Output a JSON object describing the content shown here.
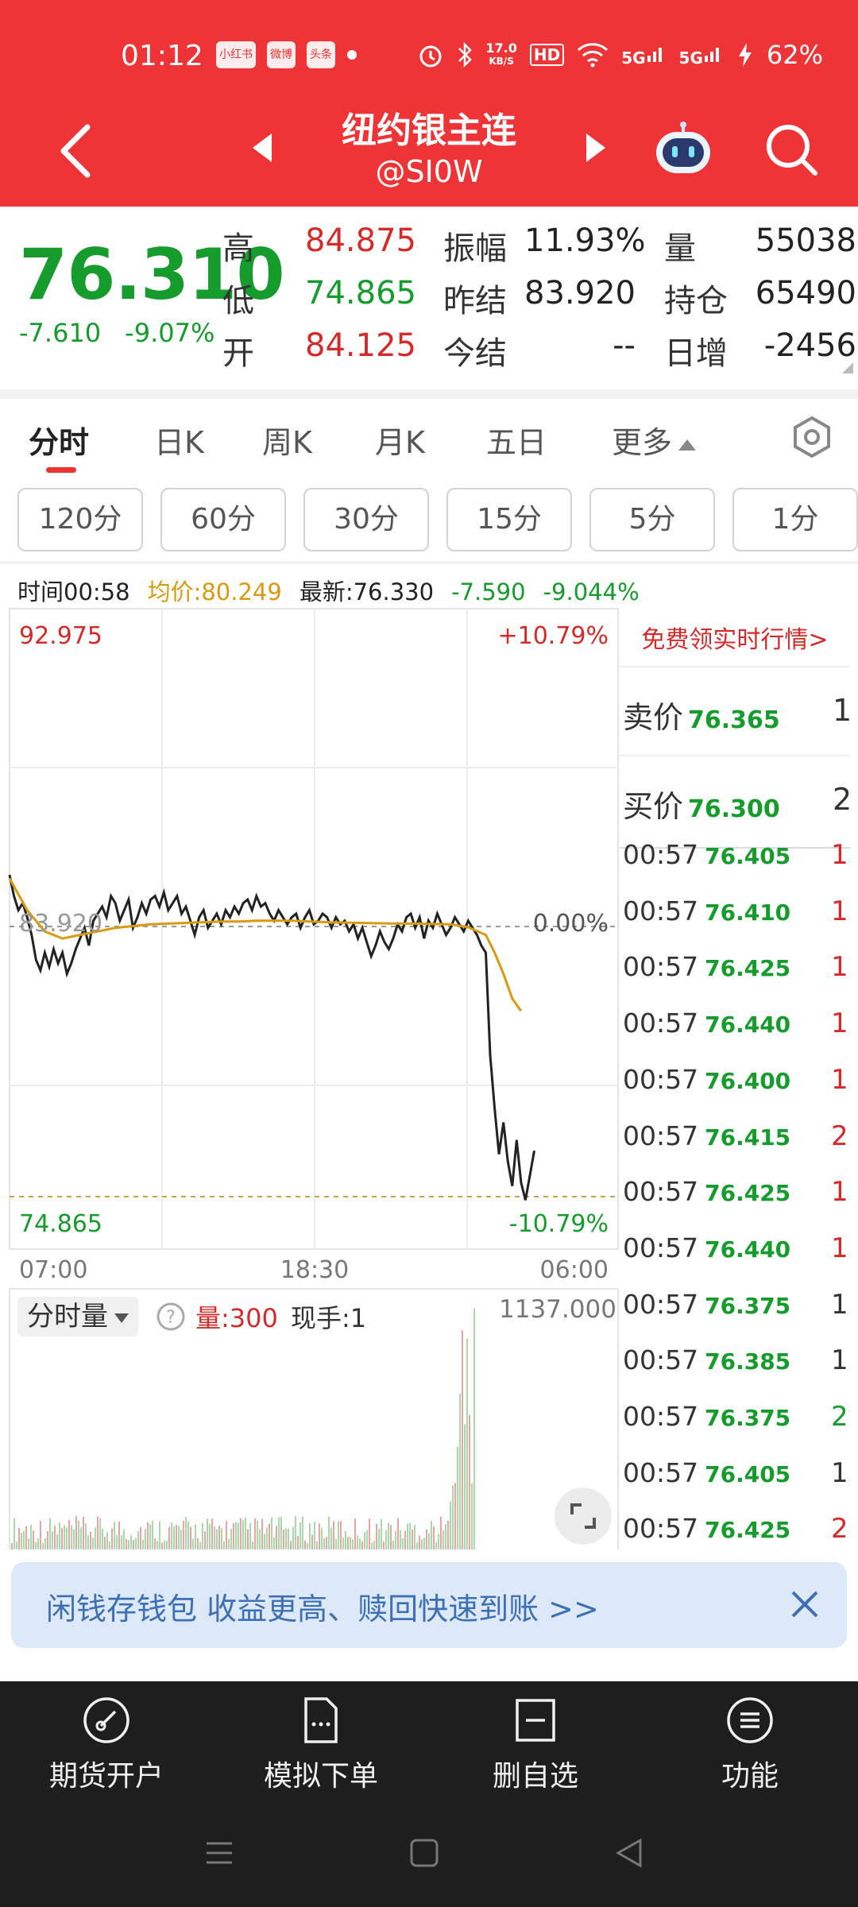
{
  "status_bar": {
    "time": "01:12",
    "app_badges": [
      "小红书",
      "微博",
      "头条"
    ],
    "net_speed_value": "17.0",
    "net_speed_unit": "KB/S",
    "hd_label": "HD",
    "signal_1": "5G",
    "signal_2": "5G",
    "battery": "62%"
  },
  "header": {
    "title": "纽约银主连",
    "subtitle": "@SI0W"
  },
  "quote": {
    "last_price": "76.310",
    "change": "-7.610",
    "change_pct": "-9.07%",
    "fields": [
      {
        "label": "高",
        "value": "84.875",
        "color": "red"
      },
      {
        "label": "低",
        "value": "74.865",
        "color": "green"
      },
      {
        "label": "开",
        "value": "84.125",
        "color": "red"
      },
      {
        "label": "振幅",
        "value": "11.93%",
        "color": "black"
      },
      {
        "label": "昨结",
        "value": "83.920",
        "color": "black"
      },
      {
        "label": "今结",
        "value": "--",
        "color": "black"
      },
      {
        "label": "量",
        "value": "55038",
        "color": "black"
      },
      {
        "label": "持仓",
        "value": "65490",
        "color": "black"
      },
      {
        "label": "日增",
        "value": "-2456",
        "color": "black"
      }
    ]
  },
  "tabs": [
    {
      "label": "分时",
      "active": true
    },
    {
      "label": "日K",
      "active": false
    },
    {
      "label": "周K",
      "active": false
    },
    {
      "label": "月K",
      "active": false
    },
    {
      "label": "五日",
      "active": false
    },
    {
      "label": "更多",
      "active": false
    }
  ],
  "periods": [
    "120分",
    "60分",
    "30分",
    "15分",
    "5分",
    "1分"
  ],
  "info_line": {
    "time": "时间00:58",
    "avg": "均价:80.249",
    "latest": "最新:76.330",
    "change": "-7.590",
    "change_pct": "-9.044%"
  },
  "chart_data": {
    "type": "line",
    "y_top_label": "92.975",
    "y_bottom_label": "74.865",
    "y_mid_label": "83.920",
    "pct_top_label": "+10.79%",
    "pct_mid_label": "0.00%",
    "pct_bottom_label": "-10.79%",
    "x_labels": [
      "07:00",
      "18:30",
      "06:00"
    ],
    "ylim": [
      74.865,
      92.975
    ],
    "xlim": [
      0,
      1380
    ],
    "series": [
      {
        "values_x": [
          0,
          10,
          20,
          30,
          40,
          50,
          60,
          70,
          80,
          90,
          100,
          110,
          120,
          130,
          140,
          150,
          160,
          170,
          180,
          190,
          200,
          210,
          220,
          230,
          240,
          250,
          260,
          270,
          280,
          290,
          300,
          310,
          320,
          330,
          340,
          350,
          360,
          370,
          380,
          390,
          400,
          410,
          420,
          430,
          440,
          450,
          460,
          470,
          480,
          490,
          500,
          510,
          520,
          530,
          540,
          550,
          560,
          570,
          580,
          590,
          600,
          610,
          620,
          630,
          640,
          650,
          660,
          670,
          680,
          690,
          700,
          710,
          720,
          730,
          740,
          750,
          760,
          770,
          780,
          790,
          800,
          810,
          820,
          830,
          840,
          850,
          860,
          870,
          880,
          890,
          900,
          910,
          920,
          930,
          940,
          950,
          960,
          970,
          980,
          990,
          1000,
          1010,
          1020,
          1030,
          1040,
          1050,
          1060,
          1070,
          1080,
          1090,
          1100,
          1110,
          1120,
          1130,
          1140,
          1150,
          1160,
          1170,
          1180,
          1190,
          1200,
          1210,
          1220,
          1230,
          1240,
          1250,
          1260,
          1270,
          1280,
          1290,
          1300,
          1310,
          1320,
          1330
        ],
        "values": [
          84.1,
          83.5,
          83.1,
          83.3,
          82.9,
          82.4,
          81.7,
          81.4,
          81.9,
          81.5,
          82.0,
          81.6,
          81.9,
          81.3,
          81.6,
          82.0,
          82.3,
          82.6,
          82.1,
          82.8,
          83.0,
          83.2,
          82.9,
          83.5,
          83.3,
          82.8,
          83.1,
          83.4,
          82.6,
          82.9,
          83.3,
          83.0,
          83.4,
          83.5,
          83.2,
          83.6,
          83.1,
          83.3,
          83.5,
          83.0,
          83.2,
          82.8,
          82.4,
          82.9,
          83.1,
          82.6,
          82.8,
          83.0,
          82.7,
          83.1,
          82.9,
          83.2,
          83.0,
          83.3,
          83.4,
          83.1,
          83.5,
          83.2,
          83.3,
          83.0,
          82.8,
          83.1,
          82.9,
          82.7,
          82.9,
          83.0,
          82.6,
          82.9,
          83.1,
          82.7,
          82.8,
          83.0,
          82.9,
          82.6,
          82.9,
          82.7,
          82.8,
          82.5,
          82.7,
          82.3,
          82.6,
          82.2,
          81.8,
          82.1,
          82.5,
          82.2,
          82.0,
          82.3,
          82.7,
          82.5,
          82.9,
          83.0,
          82.6,
          82.9,
          82.3,
          82.8,
          82.6,
          83.0,
          82.7,
          82.4,
          82.6,
          82.9,
          82.7,
          82.5,
          82.8,
          82.6,
          82.4,
          82.1,
          81.9,
          79.0,
          77.5,
          76.2,
          77.1,
          76.0,
          75.3,
          76.6,
          75.4,
          74.9,
          75.6,
          76.3
        ],
        "name": ""
      },
      {
        "values_x": [
          0,
          40,
          80,
          120,
          160,
          200,
          240,
          280,
          320,
          360,
          400,
          440,
          480,
          520,
          560,
          600,
          640,
          680,
          720,
          760,
          800,
          840,
          880,
          920,
          960,
          1000,
          1040,
          1080,
          1100,
          1120,
          1140,
          1160
        ],
        "values": [
          84.0,
          83.1,
          82.5,
          82.3,
          82.4,
          82.5,
          82.6,
          82.65,
          82.7,
          82.72,
          82.74,
          82.76,
          82.78,
          82.78,
          82.8,
          82.8,
          82.8,
          82.78,
          82.76,
          82.75,
          82.74,
          82.73,
          82.72,
          82.72,
          82.71,
          82.7,
          82.62,
          82.4,
          81.9,
          81.3,
          80.6,
          80.25
        ],
        "name": ""
      }
    ]
  },
  "order_panel": {
    "promo": "免费领实时行情>",
    "sell": {
      "label": "卖价",
      "price": "76.365",
      "count": "1"
    },
    "buy": {
      "label": "买价",
      "price": "76.300",
      "count": "2"
    },
    "trades": [
      {
        "time": "00:57",
        "price": "76.405",
        "qty": "1",
        "color": "red"
      },
      {
        "time": "00:57",
        "price": "76.410",
        "qty": "1",
        "color": "red"
      },
      {
        "time": "00:57",
        "price": "76.425",
        "qty": "1",
        "color": "red"
      },
      {
        "time": "00:57",
        "price": "76.440",
        "qty": "1",
        "color": "red"
      },
      {
        "time": "00:57",
        "price": "76.400",
        "qty": "1",
        "color": "red"
      },
      {
        "time": "00:57",
        "price": "76.415",
        "qty": "2",
        "color": "red"
      },
      {
        "time": "00:57",
        "price": "76.425",
        "qty": "1",
        "color": "red"
      },
      {
        "time": "00:57",
        "price": "76.440",
        "qty": "1",
        "color": "red"
      },
      {
        "time": "00:57",
        "price": "76.375",
        "qty": "1",
        "color": "black"
      },
      {
        "time": "00:57",
        "price": "76.385",
        "qty": "1",
        "color": "black"
      },
      {
        "time": "00:57",
        "price": "76.375",
        "qty": "2",
        "color": "green"
      },
      {
        "time": "00:57",
        "price": "76.405",
        "qty": "1",
        "color": "black"
      },
      {
        "time": "00:57",
        "price": "76.425",
        "qty": "2",
        "color": "red"
      }
    ]
  },
  "volume": {
    "dropdown": "分时量",
    "vol": "量:300",
    "hand": "现手:1",
    "max": "1137.000"
  },
  "banner": {
    "text": "闲钱存钱包 收益更高、赎回快速到账 >>"
  },
  "bottom_bar": [
    {
      "label": "期货开户",
      "icon": "gauge-icon"
    },
    {
      "label": "模拟下单",
      "icon": "document-icon"
    },
    {
      "label": "删自选",
      "icon": "minus-square-icon"
    },
    {
      "label": "功能",
      "icon": "menu-circle-icon"
    }
  ],
  "colors": {
    "header": "#ee3436",
    "up": "#d62a2a",
    "down": "#169c2c",
    "avg_line": "#d99a10",
    "bottom_bar": "#1e1e1e"
  }
}
